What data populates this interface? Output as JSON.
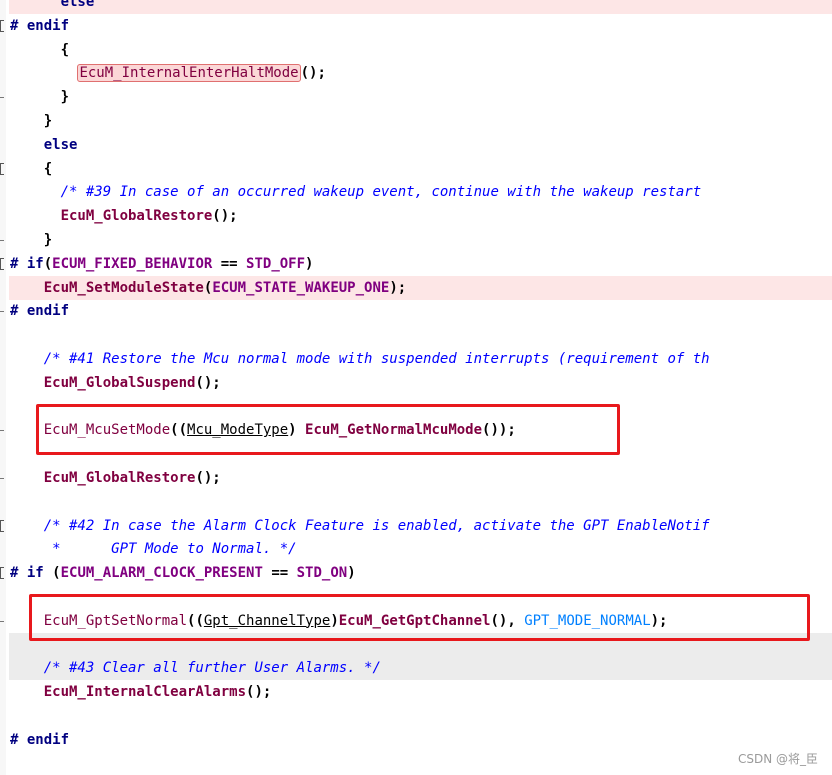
{
  "lines": [
    {
      "indent": "      ",
      "highlight": "pink",
      "tokens": [
        {
          "t": "else",
          "c": "kw"
        }
      ]
    },
    {
      "indent": "",
      "gutter": "box",
      "tokens": [
        {
          "t": "# endif",
          "c": "pre"
        }
      ]
    },
    {
      "indent": "      ",
      "tokens": [
        {
          "t": "{",
          "c": "punct"
        }
      ]
    },
    {
      "indent": "        ",
      "tokens": [
        {
          "t": "EcuM_InternalEnterHaltMode",
          "c": "fn2",
          "boxed": true
        },
        {
          "t": "();",
          "c": "punct"
        }
      ]
    },
    {
      "indent": "      ",
      "gutter": "dash",
      "tokens": [
        {
          "t": "}",
          "c": "punct"
        }
      ]
    },
    {
      "indent": "    ",
      "tokens": [
        {
          "t": "}",
          "c": "punct"
        }
      ]
    },
    {
      "indent": "    ",
      "tokens": [
        {
          "t": "else",
          "c": "kw"
        }
      ]
    },
    {
      "indent": "    ",
      "gutter": "box",
      "tokens": [
        {
          "t": "{",
          "c": "punct"
        }
      ]
    },
    {
      "indent": "      ",
      "tokens": [
        {
          "t": "/* #39 In case of an occurred wakeup event, continue with the wakeup restart",
          "c": "cmt"
        }
      ]
    },
    {
      "indent": "      ",
      "tokens": [
        {
          "t": "EcuM_GlobalRestore",
          "c": "fn"
        },
        {
          "t": "();",
          "c": "punct"
        }
      ]
    },
    {
      "indent": "    ",
      "gutter": "dash",
      "tokens": [
        {
          "t": "}",
          "c": "punct"
        }
      ]
    },
    {
      "indent": "",
      "gutter": "box",
      "tokens": [
        {
          "t": "# if",
          "c": "pre"
        },
        {
          "t": "(",
          "c": "punct"
        },
        {
          "t": "ECUM_FIXED_BEHAVIOR",
          "c": "const"
        },
        {
          "t": " == ",
          "c": "punct"
        },
        {
          "t": "STD_OFF",
          "c": "const"
        },
        {
          "t": ")",
          "c": "punct"
        }
      ]
    },
    {
      "indent": "    ",
      "highlight": "pink",
      "tokens": [
        {
          "t": "EcuM_SetModuleState",
          "c": "fn"
        },
        {
          "t": "(",
          "c": "punct"
        },
        {
          "t": "ECUM_STATE_WAKEUP_ONE",
          "c": "const"
        },
        {
          "t": ");",
          "c": "punct"
        }
      ]
    },
    {
      "indent": "",
      "gutter": "dash",
      "tokens": [
        {
          "t": "# endif",
          "c": "pre"
        }
      ]
    },
    {
      "indent": "",
      "tokens": []
    },
    {
      "indent": "    ",
      "tokens": [
        {
          "t": "/* #41 Restore the Mcu normal mode with suspended interrupts (requirement of th",
          "c": "cmt"
        }
      ]
    },
    {
      "indent": "    ",
      "tokens": [
        {
          "t": "EcuM_GlobalSuspend",
          "c": "fn"
        },
        {
          "t": "();",
          "c": "punct"
        }
      ]
    },
    {
      "indent": "",
      "tokens": []
    },
    {
      "indent": "    ",
      "gutter": "dash",
      "tokens": [
        {
          "t": "EcuM_McuSetMode",
          "c": "fn2"
        },
        {
          "t": "((",
          "c": "punct"
        },
        {
          "t": "Mcu_ModeType",
          "c": "type"
        },
        {
          "t": ") ",
          "c": "punct"
        },
        {
          "t": "EcuM_GetNormalMcuMode",
          "c": "fn"
        },
        {
          "t": "());",
          "c": "punct"
        }
      ]
    },
    {
      "indent": "",
      "tokens": []
    },
    {
      "indent": "    ",
      "gutter": "dash",
      "tokens": [
        {
          "t": "EcuM_GlobalRestore",
          "c": "fn"
        },
        {
          "t": "();",
          "c": "punct"
        }
      ]
    },
    {
      "indent": "",
      "tokens": []
    },
    {
      "indent": "    ",
      "gutter": "box",
      "tokens": [
        {
          "t": "/* #42 In case the Alarm Clock Feature is enabled, activate the GPT EnableNotif",
          "c": "cmt"
        }
      ]
    },
    {
      "indent": "     ",
      "tokens": [
        {
          "t": "*      GPT Mode to Normal. */",
          "c": "cmt"
        }
      ]
    },
    {
      "indent": "",
      "gutter": "box",
      "tokens": [
        {
          "t": "# if ",
          "c": "pre"
        },
        {
          "t": "(",
          "c": "punct"
        },
        {
          "t": "ECUM_ALARM_CLOCK_PRESENT",
          "c": "const"
        },
        {
          "t": " == ",
          "c": "punct"
        },
        {
          "t": "STD_ON",
          "c": "const"
        },
        {
          "t": ")",
          "c": "punct"
        }
      ]
    },
    {
      "indent": "",
      "tokens": []
    },
    {
      "indent": "    ",
      "gutter": "dash",
      "tokens": [
        {
          "t": "EcuM_GptSetNormal",
          "c": "fn2"
        },
        {
          "t": "((",
          "c": "punct"
        },
        {
          "t": "Gpt_ChannelType",
          "c": "type"
        },
        {
          "t": ")",
          "c": "punct"
        },
        {
          "t": "EcuM_GetGptChannel",
          "c": "fn"
        },
        {
          "t": "(), ",
          "c": "punct"
        },
        {
          "t": "GPT_MODE_NORMAL",
          "c": "enum"
        },
        {
          "t": ");",
          "c": "punct"
        }
      ]
    },
    {
      "indent": "",
      "highlight": "gray",
      "tokens": []
    },
    {
      "indent": "    ",
      "highlight": "gray",
      "tokens": [
        {
          "t": "/* #43 Clear all further User Alarms. */",
          "c": "cmt"
        }
      ]
    },
    {
      "indent": "    ",
      "tokens": [
        {
          "t": "EcuM_InternalClearAlarms",
          "c": "fn"
        },
        {
          "t": "();",
          "c": "punct"
        }
      ]
    },
    {
      "indent": "",
      "tokens": []
    },
    {
      "indent": "",
      "tokens": [
        {
          "t": "# endif",
          "c": "pre"
        }
      ]
    }
  ],
  "watermark": "CSDN @将_臣"
}
